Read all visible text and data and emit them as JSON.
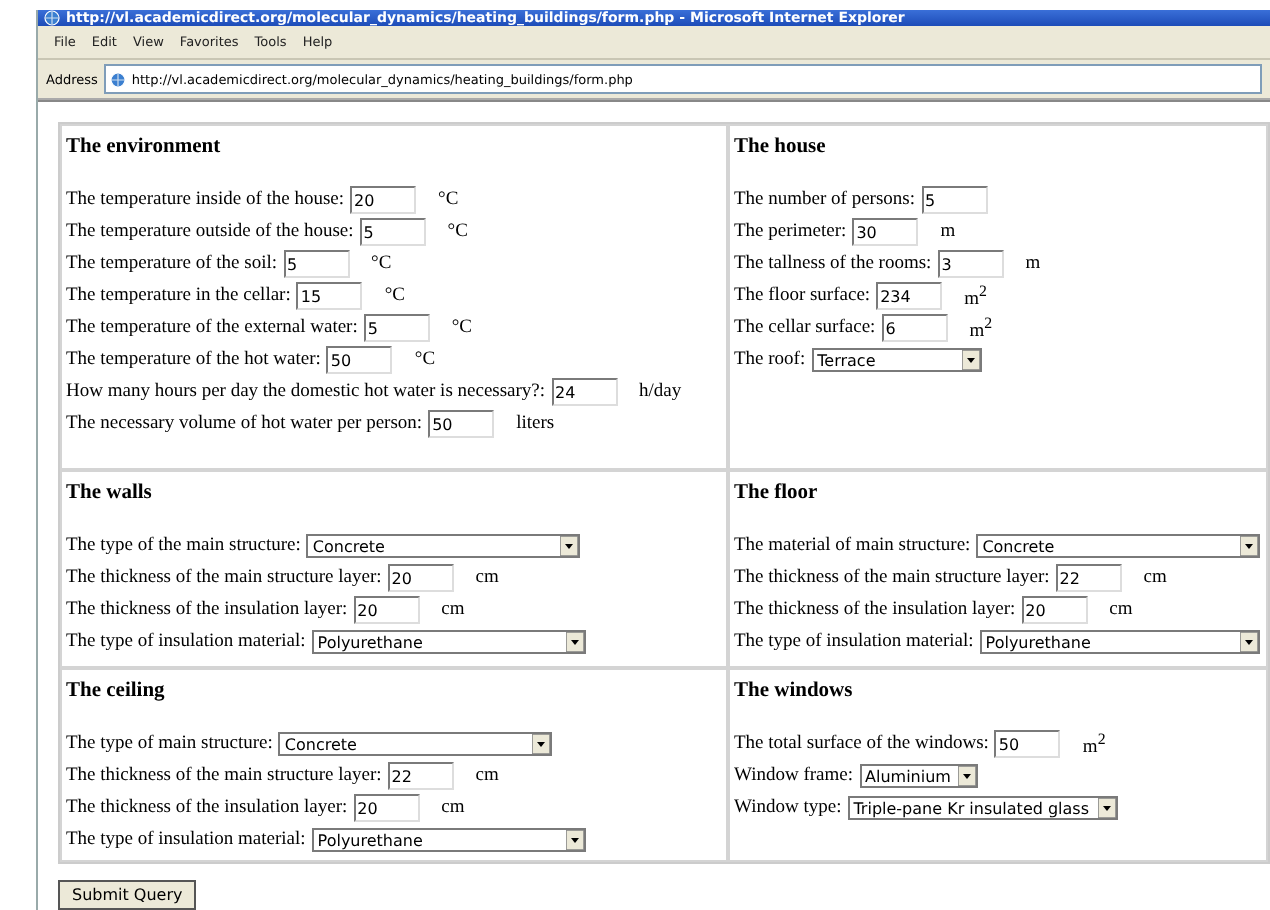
{
  "window": {
    "title": "http://vl.academicdirect.org/molecular_dynamics/heating_buildings/form.php - Microsoft Internet Explorer"
  },
  "menu": [
    "File",
    "Edit",
    "View",
    "Favorites",
    "Tools",
    "Help"
  ],
  "address": {
    "label": "Address",
    "url": "http://vl.academicdirect.org/molecular_dynamics/heating_buildings/form.php"
  },
  "sections": [
    {
      "title": "The environment",
      "fields": [
        {
          "kind": "text",
          "label": "The temperature inside of the house:",
          "value": "20",
          "unit": "°C"
        },
        {
          "kind": "text",
          "label": "The temperature outside of the house:",
          "value": "5",
          "unit": "°C"
        },
        {
          "kind": "text",
          "label": "The temperature of the soil:",
          "value": "5",
          "unit": "°C"
        },
        {
          "kind": "text",
          "label": "The temperature in the cellar:",
          "value": "15",
          "unit": "°C"
        },
        {
          "kind": "text",
          "label": "The temperature of the external water:",
          "value": "5",
          "unit": "°C"
        },
        {
          "kind": "text",
          "label": "The temperature of the hot water:",
          "value": "50",
          "unit": "°C"
        },
        {
          "kind": "text",
          "label": "How many hours per day the domestic hot water is necessary?:",
          "value": "24",
          "unit": "h/day"
        },
        {
          "kind": "text",
          "label": "The necessary volume of hot water per person:",
          "value": "50",
          "unit": "liters"
        }
      ]
    },
    {
      "title": "The house",
      "fields": [
        {
          "kind": "text",
          "label": "The number of persons:",
          "value": "5"
        },
        {
          "kind": "text",
          "label": "The perimeter:",
          "value": "30",
          "unit": "m"
        },
        {
          "kind": "text",
          "label": "The tallness of the rooms:",
          "value": "3",
          "unit": "m"
        },
        {
          "kind": "text",
          "label": "The floor surface:",
          "value": "234",
          "unit": "m$^{2}$"
        },
        {
          "kind": "text",
          "label": "The cellar surface:",
          "value": "6",
          "unit": "m$^{2}$"
        },
        {
          "kind": "select",
          "label": "The roof:",
          "value": "Terrace"
        }
      ]
    },
    {
      "title": "The walls",
      "fields": [
        {
          "kind": "select",
          "label": "The type of the main structure:",
          "value": "Concrete"
        },
        {
          "kind": "text",
          "label": "The thickness of the main structure layer:",
          "value": "20",
          "unit": "cm"
        },
        {
          "kind": "text",
          "label": "The thickness of the insulation layer:",
          "value": "20",
          "unit": "cm"
        },
        {
          "kind": "select",
          "label": "The type of insulation material:",
          "value": "Polyurethane"
        }
      ]
    },
    {
      "title": "The floor",
      "fields": [
        {
          "kind": "select",
          "label": "The material of main structure:",
          "value": "Concrete"
        },
        {
          "kind": "text",
          "label": "The thickness of the main structure layer:",
          "value": "22",
          "unit": "cm"
        },
        {
          "kind": "text",
          "label": "The thickness of the insulation layer:",
          "value": "20",
          "unit": "cm"
        },
        {
          "kind": "select",
          "label": "The type of insulation material:",
          "value": "Polyurethane"
        }
      ]
    },
    {
      "title": "The ceiling",
      "fields": [
        {
          "kind": "select",
          "label": "The type of main structure:",
          "value": "Concrete"
        },
        {
          "kind": "text",
          "label": "The thickness of the main structure layer:",
          "value": "22",
          "unit": "cm"
        },
        {
          "kind": "text",
          "label": "The thickness of the insulation layer:",
          "value": "20",
          "unit": "cm"
        },
        {
          "kind": "select",
          "label": "The type of insulation material:",
          "value": "Polyurethane"
        }
      ]
    },
    {
      "title": "The windows",
      "fields": [
        {
          "kind": "text",
          "label": "The total surface of the windows:",
          "value": "50",
          "unit": "m$^{2}$"
        },
        {
          "kind": "select",
          "label": "Window frame:",
          "value": "Aluminium"
        },
        {
          "kind": "select",
          "label": "Window type:",
          "value": "Triple-pane Kr insulated glass"
        }
      ]
    }
  ],
  "submit": "Submit Query"
}
